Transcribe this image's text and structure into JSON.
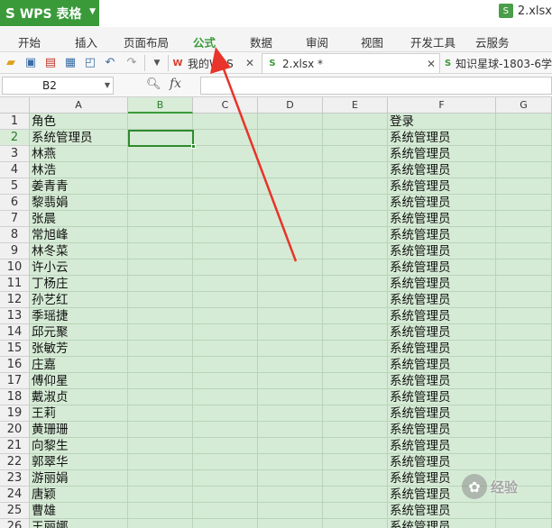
{
  "app": {
    "name": "WPS 表格",
    "logo": "S"
  },
  "window": {
    "file_title": "2.xlsx"
  },
  "menu": {
    "tabs": [
      "开始",
      "插入",
      "页面布局",
      "公式",
      "数据",
      "审阅",
      "视图",
      "开发工具",
      "云服务"
    ],
    "active": "公式"
  },
  "toolbar": {
    "icons": [
      "open-folder-icon",
      "save-icon",
      "export-pdf-icon",
      "print-icon",
      "print-preview-icon",
      "undo-icon",
      "redo-icon",
      "dropdown-icon"
    ],
    "doc_tabs": [
      {
        "label": "我的WPS",
        "icon": "W",
        "color": "#d93b2b"
      },
      {
        "label": "2.xlsx *",
        "icon": "S",
        "color": "#3a9a3a"
      },
      {
        "label": "知识星球-1803-6学",
        "icon": "S",
        "color": "#3a9a3a"
      }
    ]
  },
  "formula_bar": {
    "name_box": "B2",
    "fx": "fx",
    "formula": ""
  },
  "grid": {
    "columns": [
      "A",
      "B",
      "C",
      "D",
      "E",
      "F",
      "G"
    ],
    "selected_column": "B",
    "selected_row": 2,
    "rows": [
      {
        "n": "1",
        "a": "角色",
        "f": "登录"
      },
      {
        "n": "2",
        "a": "系统管理员",
        "f": "系统管理员"
      },
      {
        "n": "3",
        "a": "林燕",
        "f": "系统管理员"
      },
      {
        "n": "4",
        "a": "林浩",
        "f": "系统管理员"
      },
      {
        "n": "5",
        "a": "姜青青",
        "f": "系统管理员"
      },
      {
        "n": "6",
        "a": "黎翡娟",
        "f": "系统管理员"
      },
      {
        "n": "7",
        "a": "张晨",
        "f": "系统管理员"
      },
      {
        "n": "8",
        "a": "常旭峰",
        "f": "系统管理员"
      },
      {
        "n": "9",
        "a": "林冬菜",
        "f": "系统管理员"
      },
      {
        "n": "10",
        "a": "许小云",
        "f": "系统管理员"
      },
      {
        "n": "11",
        "a": "丁杨庄",
        "f": "系统管理员"
      },
      {
        "n": "12",
        "a": "孙艺红",
        "f": "系统管理员"
      },
      {
        "n": "13",
        "a": "季瑶捷",
        "f": "系统管理员"
      },
      {
        "n": "14",
        "a": "邱元聚",
        "f": "系统管理员"
      },
      {
        "n": "15",
        "a": "张敏芳",
        "f": "系统管理员"
      },
      {
        "n": "16",
        "a": "庄嘉",
        "f": "系统管理员"
      },
      {
        "n": "17",
        "a": "傅仰星",
        "f": "系统管理员"
      },
      {
        "n": "18",
        "a": "戴淑贞",
        "f": "系统管理员"
      },
      {
        "n": "19",
        "a": "王莉",
        "f": "系统管理员"
      },
      {
        "n": "20",
        "a": "黄珊珊",
        "f": "系统管理员"
      },
      {
        "n": "21",
        "a": "向黎生",
        "f": "系统管理员"
      },
      {
        "n": "22",
        "a": "郭翠华",
        "f": "系统管理员"
      },
      {
        "n": "23",
        "a": "游丽娟",
        "f": "系统管理员"
      },
      {
        "n": "24",
        "a": "唐颖",
        "f": "系统管理员"
      },
      {
        "n": "25",
        "a": "曹雄",
        "f": "系统管理员"
      },
      {
        "n": "26",
        "a": "王丽娜",
        "f": "系统管理员"
      }
    ]
  },
  "watermark": {
    "text": "经验",
    "icon": "paw-icon"
  },
  "colors": {
    "accent": "#3a9a3a",
    "grid_fill": "#d5ebd5",
    "annotation_arrow": "#e8342a"
  }
}
